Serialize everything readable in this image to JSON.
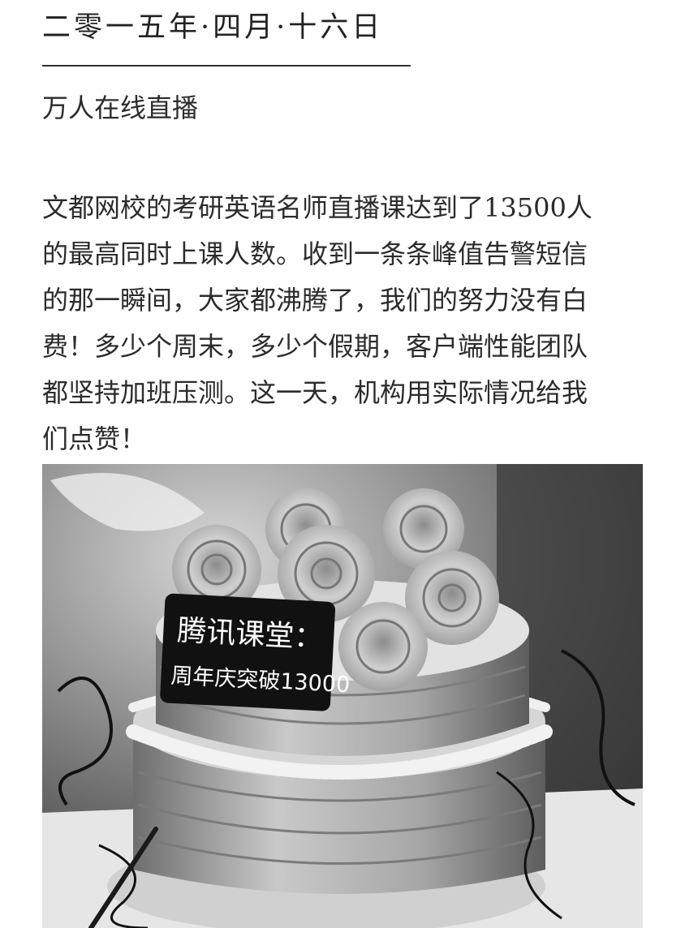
{
  "header": {
    "date": "二零一五年·四月·十六日",
    "subtitle": "万人在线直播"
  },
  "body": {
    "lines": [
      "文都网校的考研英语名师直播课达到了13500人",
      "的最高同时上课人数。收到一条条峰值告警短信",
      "的那一瞬间，大家都沸腾了，我们的努力没有白",
      "费！多少个周末，多少个假期，客户端性能团队",
      "都坚持加班压测。这一天，机构用实际情况给我",
      "们点赞！"
    ]
  },
  "photo": {
    "sign_line1": "腾讯课堂：",
    "sign_line2": "周年庆突破13000"
  }
}
